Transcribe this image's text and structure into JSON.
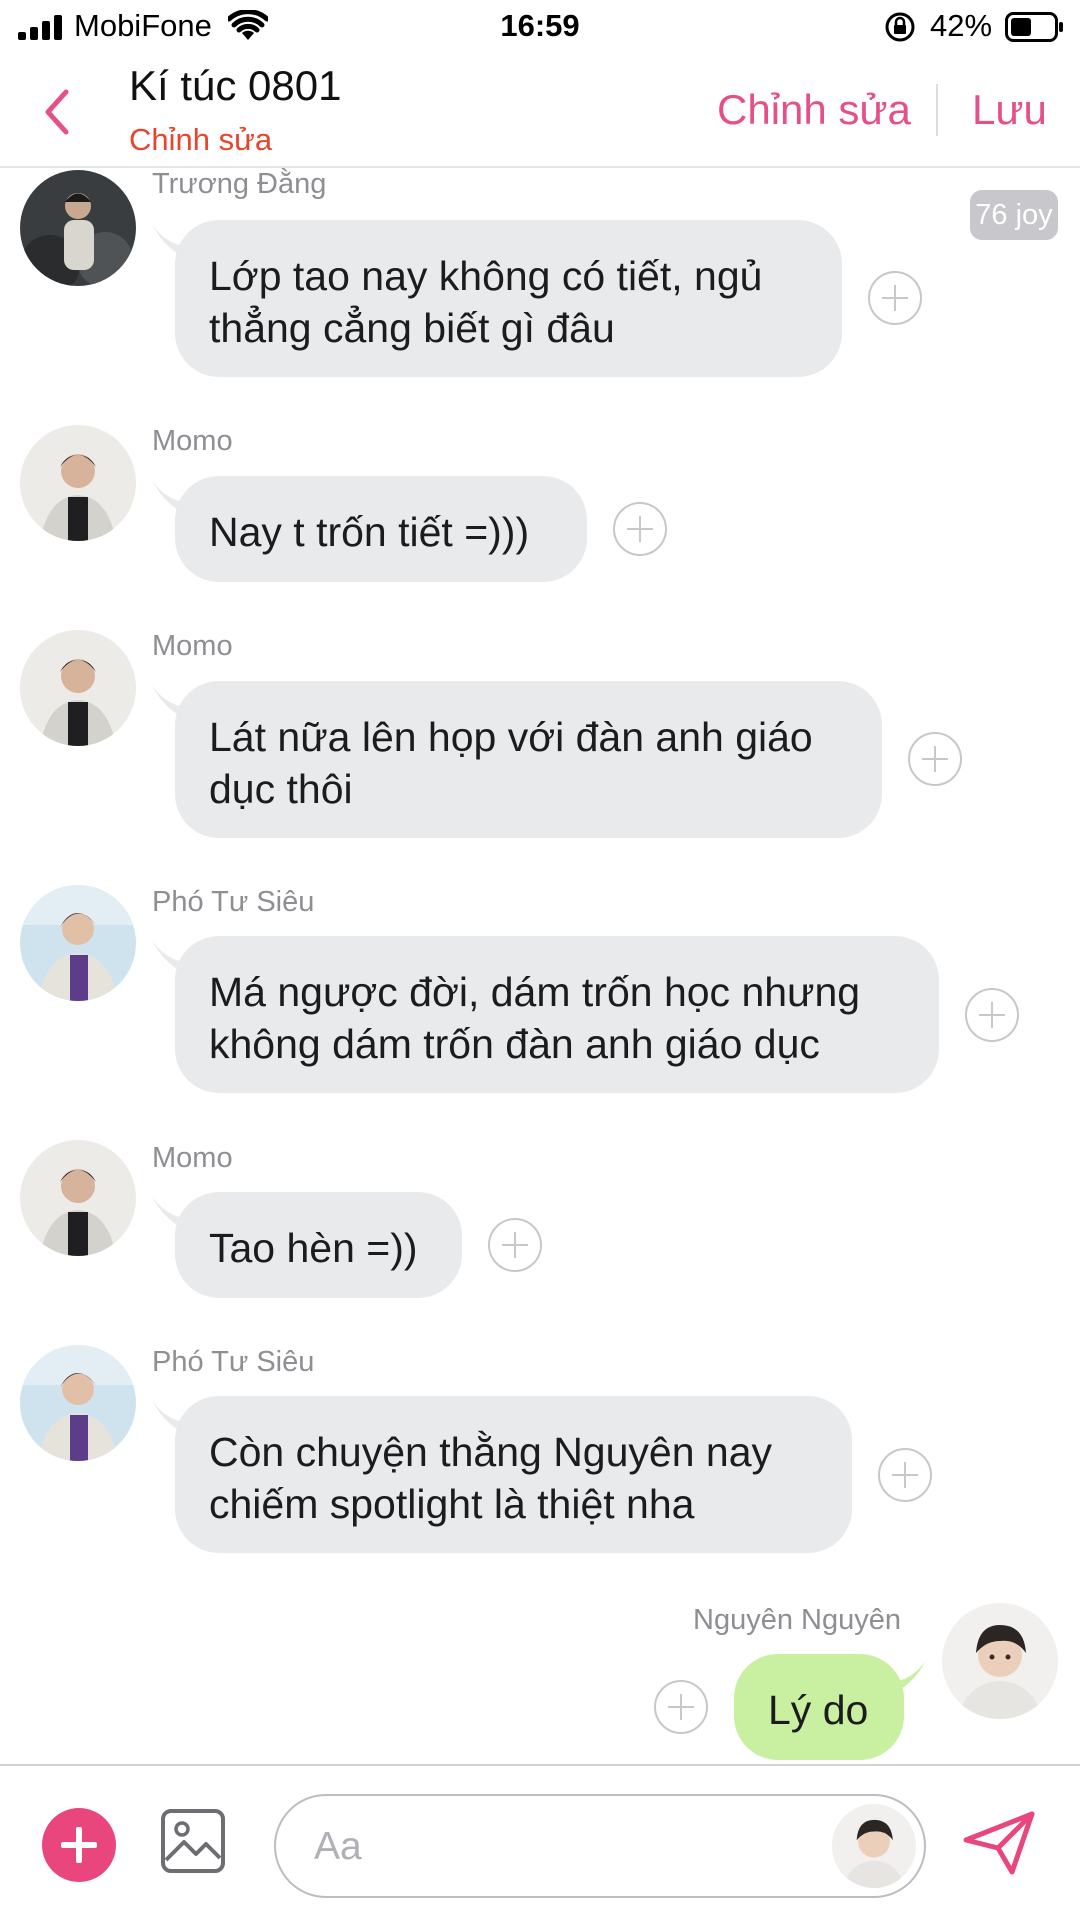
{
  "status_bar": {
    "carrier": "MobiFone",
    "time": "16:59",
    "battery": "42%"
  },
  "header": {
    "title": "Kí túc 0801",
    "subtitle": "Chỉnh sửa",
    "edit_label": "Chỉnh sửa",
    "save_label": "Lưu"
  },
  "messages": [
    {
      "sender": "Trương Đằng",
      "lines": [
        "Lớp tao nay không có tiết, ngủ",
        "thẳng cẳng biết gì đâu"
      ]
    },
    {
      "sender": "Momo",
      "lines": [
        "Nay t trốn tiết =)))"
      ]
    },
    {
      "sender": "Momo",
      "lines": [
        "Lát nữa lên họp với đàn anh giáo",
        "dục thôi"
      ]
    },
    {
      "sender": "Phó Tư Siêu",
      "lines": [
        "Má ngược đời, dám trốn học nhưng",
        "không dám trốn đàn anh giáo dục"
      ]
    },
    {
      "sender": "Momo",
      "lines": [
        "Tao hèn =))"
      ]
    },
    {
      "sender": "Phó Tư Siêu",
      "lines": [
        "Còn chuyện thằng Nguyên nay",
        "chiếm spotlight là thiệt nha"
      ]
    },
    {
      "sender": "Nguyên Nguyên",
      "lines": [
        "Lý do"
      ]
    }
  ],
  "joy_badge": "76 joy",
  "composer": {
    "placeholder": "Aa"
  },
  "colors": {
    "accent": "#e5508a",
    "subtitle_red": "#e8452c",
    "bubble_other": "#e9eaec",
    "bubble_self": "#c9efa1"
  },
  "icons": [
    "signal-icon",
    "wifi-icon",
    "rotation-lock-icon",
    "battery-icon",
    "chevron-left-icon",
    "add-reaction-icon",
    "plus-icon",
    "image-icon",
    "send-icon"
  ]
}
